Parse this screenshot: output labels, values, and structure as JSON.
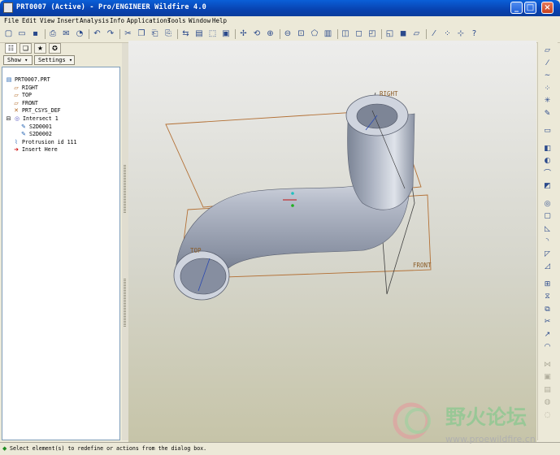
{
  "window": {
    "title": "PRT0007 (Active) - Pro/ENGINEER Wildfire 4.0",
    "controls": [
      "_",
      "□",
      "×"
    ]
  },
  "menu": [
    "File",
    "Edit",
    "View",
    "Insert",
    "Analysis",
    "Info",
    "Applications",
    "Tools",
    "Window",
    "Help"
  ],
  "toolbar_icons": [
    {
      "name": "new-icon",
      "glyph": "▢"
    },
    {
      "name": "open-icon",
      "glyph": "▭"
    },
    {
      "name": "save-icon",
      "glyph": "▪"
    },
    {
      "name": "print-icon",
      "glyph": "⎙"
    },
    {
      "name": "send-icon",
      "glyph": "✉"
    },
    {
      "name": "repaint-mode-icon",
      "glyph": "◔"
    },
    {
      "name": "undo-icon",
      "glyph": "↶"
    },
    {
      "name": "redo-icon",
      "glyph": "↷"
    },
    {
      "name": "cut-icon",
      "glyph": "✂"
    },
    {
      "name": "copy-icon",
      "glyph": "❐"
    },
    {
      "name": "paste-icon",
      "glyph": "⎗"
    },
    {
      "name": "paste-special-icon",
      "glyph": "⎘"
    },
    {
      "name": "regenerate-icon",
      "glyph": "⇆"
    },
    {
      "name": "find-icon",
      "glyph": "▤"
    },
    {
      "name": "select-box-icon",
      "glyph": "⬚"
    },
    {
      "name": "repaint-icon",
      "glyph": "▣"
    },
    {
      "name": "spin-center-icon",
      "glyph": "✢"
    },
    {
      "name": "orient-mode-icon",
      "glyph": "⟲"
    },
    {
      "name": "zoom-in-icon",
      "glyph": "⊕"
    },
    {
      "name": "zoom-out-icon",
      "glyph": "⊖"
    },
    {
      "name": "refit-icon",
      "glyph": "⊡"
    },
    {
      "name": "reorient-icon",
      "glyph": "⬠"
    },
    {
      "name": "saved-views-icon",
      "glyph": "▥"
    },
    {
      "name": "layers-icon",
      "glyph": "◫"
    },
    {
      "name": "wireframe-icon",
      "glyph": "◻"
    },
    {
      "name": "hidden-line-icon",
      "glyph": "◰"
    },
    {
      "name": "no-hidden-icon",
      "glyph": "◱"
    },
    {
      "name": "shading-icon",
      "glyph": "◼"
    },
    {
      "name": "datum-planes-icon",
      "glyph": "▱"
    },
    {
      "name": "datum-axes-icon",
      "glyph": "⁄"
    },
    {
      "name": "datum-points-icon",
      "glyph": "⁘"
    },
    {
      "name": "coordinate-systems-icon",
      "glyph": "⊹"
    },
    {
      "name": "whats-this-icon",
      "glyph": "?"
    }
  ],
  "navigator": {
    "tabs": [
      {
        "name": "model-tree-tab-icon",
        "glyph": "☷"
      },
      {
        "name": "folder-browser-tab-icon",
        "glyph": "❏"
      },
      {
        "name": "favorites-tab-icon",
        "glyph": "★"
      },
      {
        "name": "connections-tab-icon",
        "glyph": "✪"
      }
    ],
    "show_label": "Show ▾",
    "settings_label": "Settings ▾"
  },
  "tree": [
    {
      "label": "PRT0007.PRT",
      "icon": "▤",
      "icon_name": "part-icon",
      "icon_color": "#2060b0",
      "indent": 0
    },
    {
      "label": "RIGHT",
      "icon": "▱",
      "icon_name": "datum-plane-icon",
      "icon_color": "#b0641e",
      "indent": 1
    },
    {
      "label": "TOP",
      "icon": "▱",
      "icon_name": "datum-plane-icon",
      "icon_color": "#b0641e",
      "indent": 1
    },
    {
      "label": "FRONT",
      "icon": "▱",
      "icon_name": "datum-plane-icon",
      "icon_color": "#b0641e",
      "indent": 1
    },
    {
      "label": "PRT_CSYS_DEF",
      "icon": "✕",
      "icon_name": "csys-icon",
      "icon_color": "#b0641e",
      "indent": 1
    },
    {
      "label": "Intersect 1",
      "icon": "◎",
      "icon_name": "intersect-curve-icon",
      "icon_color": "#5a5ac0",
      "indent": 1,
      "expander": "⊟"
    },
    {
      "label": "S2D0001",
      "icon": "✎",
      "icon_name": "sketch-icon",
      "icon_color": "#2060b0",
      "indent": 2
    },
    {
      "label": "S2D0002",
      "icon": "✎",
      "icon_name": "sketch-icon",
      "icon_color": "#2060b0",
      "indent": 2
    },
    {
      "label": "Protrusion id 111",
      "icon": "⌇",
      "icon_name": "sweep-protrusion-icon",
      "icon_color": "#2060b0",
      "indent": 1
    },
    {
      "label": "Insert Here",
      "icon": "➜",
      "icon_name": "insert-here-arrow-icon",
      "icon_color": "#d01010",
      "indent": 1
    }
  ],
  "datum_labels": {
    "right": "RIGHT",
    "top": "TOP",
    "front": "FRONT"
  },
  "right_toolbar": [
    {
      "name": "datum-plane-tool-icon",
      "glyph": "▱",
      "enabled": true
    },
    {
      "name": "datum-axis-tool-icon",
      "glyph": "⁄",
      "enabled": true
    },
    {
      "name": "datum-curve-tool-icon",
      "glyph": "∼",
      "enabled": true
    },
    {
      "name": "datum-point-tool-icon",
      "glyph": "⁘",
      "enabled": true
    },
    {
      "name": "csys-tool-icon",
      "glyph": "✳",
      "enabled": true
    },
    {
      "name": "analysis-tool-icon",
      "glyph": "✎",
      "enabled": true
    },
    {
      "name": "sketch-tool-icon",
      "glyph": "▭",
      "enabled": true
    },
    {
      "name": "extrude-tool-icon",
      "glyph": "◧",
      "enabled": true
    },
    {
      "name": "revolve-tool-icon",
      "glyph": "◐",
      "enabled": true
    },
    {
      "name": "variable-sweep-tool-icon",
      "glyph": "⌒",
      "enabled": true
    },
    {
      "name": "blend-tool-icon",
      "glyph": "◩",
      "enabled": true
    },
    {
      "name": "hole-tool-icon",
      "glyph": "◎",
      "enabled": true
    },
    {
      "name": "shell-tool-icon",
      "glyph": "▢",
      "enabled": true
    },
    {
      "name": "rib-tool-icon",
      "glyph": "◺",
      "enabled": true
    },
    {
      "name": "round-tool-icon",
      "glyph": "◝",
      "enabled": true
    },
    {
      "name": "chamfer-tool-icon",
      "glyph": "◸",
      "enabled": true
    },
    {
      "name": "draft-tool-icon",
      "glyph": "◿",
      "enabled": true
    },
    {
      "name": "pattern-tool-icon",
      "glyph": "⊞",
      "enabled": true
    },
    {
      "name": "mirror-tool-icon",
      "glyph": "⧖",
      "enabled": true
    },
    {
      "name": "merge-tool-icon",
      "glyph": "⧉",
      "enabled": true
    },
    {
      "name": "trim-tool-icon",
      "glyph": "✂",
      "enabled": true
    },
    {
      "name": "extend-tool-icon",
      "glyph": "↗",
      "enabled": true
    },
    {
      "name": "offset-tool-icon",
      "glyph": "◠",
      "enabled": true
    },
    {
      "name": "intersect-tool-icon",
      "glyph": "⋈",
      "enabled": false
    },
    {
      "name": "solidify-tool-icon",
      "glyph": "▣",
      "enabled": false
    },
    {
      "name": "thicken-tool-icon",
      "glyph": "▤",
      "enabled": false
    },
    {
      "name": "style-tool-icon",
      "glyph": "◍",
      "enabled": false
    },
    {
      "name": "warp-tool-icon",
      "glyph": "◌",
      "enabled": false
    }
  ],
  "status_message": "Select element(s) to redefine or actions from the dialog box.",
  "watermark": {
    "text": "野火论坛",
    "url": "www.proewildfire.cn"
  }
}
